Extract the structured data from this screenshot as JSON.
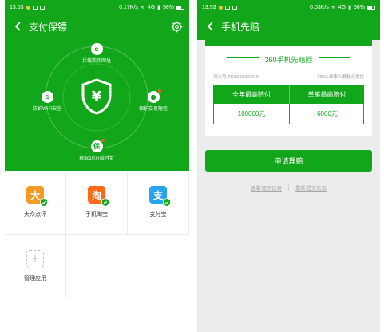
{
  "left": {
    "status": {
      "time": "13:53",
      "speed": "0.17K/s",
      "network": "4G",
      "battery": "58%"
    },
    "title": "支付保镖",
    "center_symbol": "¥",
    "features": {
      "top": "拦截欺诈网址",
      "left": "防护WiFi安全",
      "right": "保护交易短信",
      "bottom": "获取10万赔付金",
      "bottom_glyph": "保"
    },
    "apps": [
      {
        "label": "大众点评",
        "glyph": "大",
        "color": "#f39a24"
      },
      {
        "label": "手机淘宝",
        "glyph": "淘",
        "color": "#ff6a1a"
      },
      {
        "label": "支付宝",
        "glyph": "支",
        "color": "#2aa3ef"
      },
      {
        "label": "管理应用",
        "glyph": "+",
        "color": "#ffffff"
      }
    ]
  },
  "right": {
    "status": {
      "time": "13:53",
      "speed": "0.03K/s",
      "network": "4G",
      "battery": "58%"
    },
    "title": "手机先赔",
    "card": {
      "title": "360手机先赔险",
      "serial": "流水号:TK000000000",
      "provider": "360&泰康人寿联合提供",
      "col1_header": "全年最高赔付",
      "col2_header": "单笔最高赔付",
      "col1_value": "100000元",
      "col2_value": "6000元"
    },
    "claim_button": "申请理赔",
    "link_records": "查看理赔记录",
    "link_resubmit": "重新提交信息"
  },
  "colors": {
    "brand_green": "#12a61a",
    "page_gray": "#ececec"
  }
}
